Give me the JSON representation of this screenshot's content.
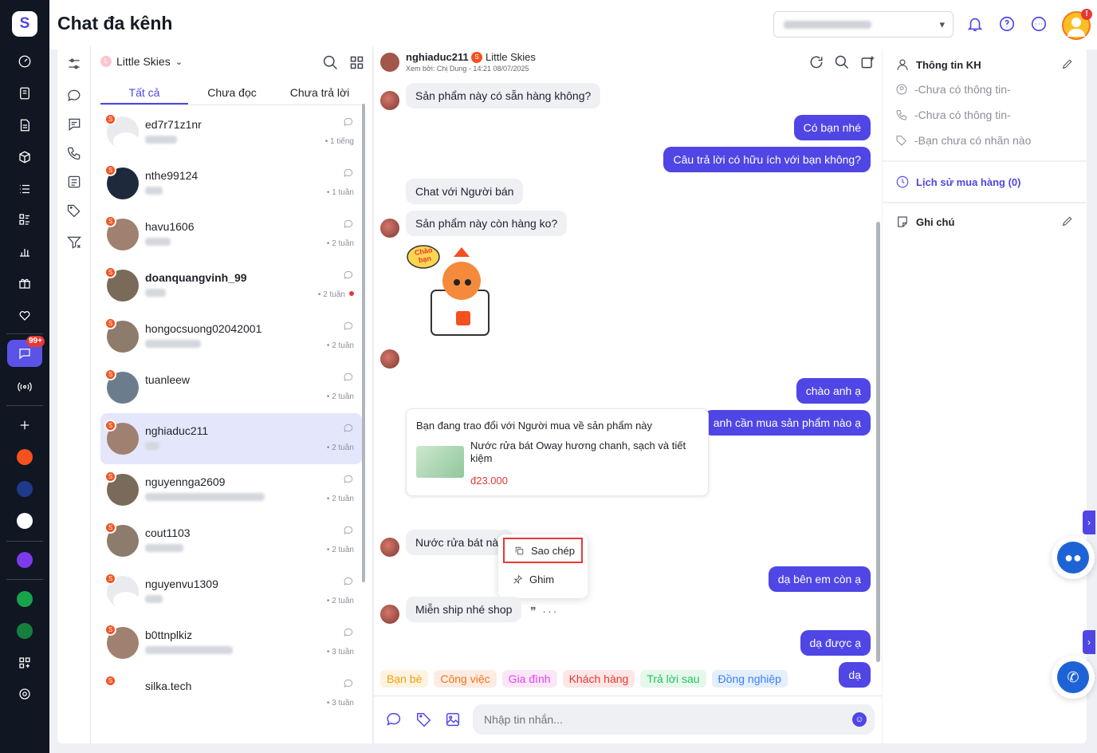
{
  "app": {
    "title": "Chat đa kênh"
  },
  "header": {
    "shop_selector_blurred": true
  },
  "shop": {
    "name": "Little Skies"
  },
  "tabs": [
    {
      "label": "Tất cả"
    },
    {
      "label": "Chưa đọc"
    },
    {
      "label": "Chưa trả lời"
    }
  ],
  "rail": {
    "badge": "99+"
  },
  "conversations": [
    {
      "name": "ed7r71z1nr",
      "time": "1 tiếng",
      "bold": false,
      "unread": false,
      "avatar": "default"
    },
    {
      "name": "nthe99124",
      "time": "1 tuần",
      "bold": false,
      "unread": false,
      "avatar": "gaming"
    },
    {
      "name": "havu1606",
      "time": "2 tuần",
      "bold": false,
      "unread": false,
      "avatar": "photo"
    },
    {
      "name": "doanquangvinh_99",
      "time": "2 tuần",
      "bold": true,
      "unread": true,
      "avatar": "photo"
    },
    {
      "name": "hongocsuong02042001",
      "time": "2 tuần",
      "bold": false,
      "unread": false,
      "avatar": "photo"
    },
    {
      "name": "tuanleew",
      "time": "2 tuần",
      "bold": false,
      "unread": false,
      "avatar": "photo"
    },
    {
      "name": "nghiaduc211",
      "time": "2 tuần",
      "bold": false,
      "unread": false,
      "avatar": "photo",
      "selected": true
    },
    {
      "name": "nguyennga2609",
      "time": "2 tuần",
      "bold": false,
      "unread": false,
      "avatar": "photo"
    },
    {
      "name": "cout1103",
      "time": "2 tuần",
      "bold": false,
      "unread": false,
      "avatar": "photo"
    },
    {
      "name": "nguyenvu1309",
      "time": "2 tuần",
      "bold": false,
      "unread": false,
      "avatar": "default"
    },
    {
      "name": "b0ttnplkiz",
      "time": "3 tuần",
      "bold": false,
      "unread": false,
      "avatar": "photo"
    },
    {
      "name": "silka.tech",
      "time": "3 tuần",
      "bold": false,
      "unread": false,
      "avatar": "silka"
    }
  ],
  "chat": {
    "customer": "nghiaduc211",
    "shop": "Little Skies",
    "seen_by": "Xem bởi: Chị Dung - 14:21 08/07/2025",
    "messages": {
      "m1": "Sản phẩm này có sẵn hàng không?",
      "m2": "Có bạn nhé",
      "m3": "Câu trả lời có hữu ích với bạn không?",
      "m4": "Chat với Người bán",
      "m5": "Sản phẩm này còn hàng ko?",
      "sticker_text": "Chào bạn",
      "m6": "chào anh ạ",
      "m7": "anh cần mua sản phẩm nào ạ",
      "m8": "Nước rửa bát này",
      "m9": "dạ bên em còn ạ",
      "m10": "Miễn ship nhé shop",
      "m11": "dạ được ạ",
      "m12": "dạ"
    },
    "product_card": {
      "title": "Bạn đang trao đổi với Người mua về sản phẩm này",
      "name": "Nước rửa bát Oway hương chanh, sạch và tiết kiệm",
      "price": "đ23.000"
    },
    "context_menu": {
      "copy": "Sao chép",
      "pin": "Ghim"
    },
    "message_actions": "❞ ···",
    "tags": [
      {
        "label": "Bạn bè",
        "color": "#f59e0b",
        "bg": "#fdf3e1"
      },
      {
        "label": "Công việc",
        "color": "#f97316",
        "bg": "#fdece3"
      },
      {
        "label": "Gia đình",
        "color": "#d946ef",
        "bg": "#fbe6f7"
      },
      {
        "label": "Khách hàng",
        "color": "#e53935",
        "bg": "#fde6e6"
      },
      {
        "label": "Trả lời sau",
        "color": "#22c55e",
        "bg": "#e6f7ec"
      },
      {
        "label": "Đồng nghiệp",
        "color": "#3b82f6",
        "bg": "#e5eefc"
      }
    ],
    "composer_placeholder": "Nhập tin nhắn..."
  },
  "customer_panel": {
    "title": "Thông tin KH",
    "name_placeholder": "-Chưa có thông tin-",
    "phone_placeholder": "-Chưa có thông tin-",
    "labels_placeholder": "-Bạn chưa có nhãn nào",
    "order_history": "Lịch sử mua hàng (0)",
    "notes": "Ghi chú"
  },
  "colors": {
    "accent": "#4f46e5",
    "rail": "#101622",
    "shopee": "#f4511e"
  }
}
